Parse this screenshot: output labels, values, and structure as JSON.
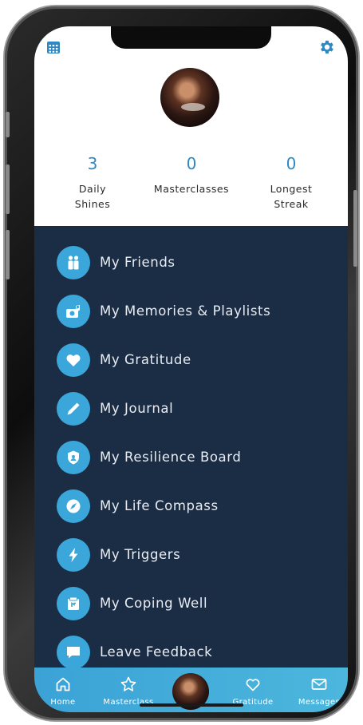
{
  "profile": {
    "stats": [
      {
        "value": "3",
        "label_line1": "Daily",
        "label_line2": "Shines"
      },
      {
        "value": "0",
        "label_line1": "Masterclasses",
        "label_line2": ""
      },
      {
        "value": "0",
        "label_line1": "Longest",
        "label_line2": "Streak"
      }
    ]
  },
  "menu": {
    "items": [
      {
        "label": "My Friends",
        "icon": "friends-icon"
      },
      {
        "label": "My Memories & Playlists",
        "icon": "memories-camera-icon"
      },
      {
        "label": "My Gratitude",
        "icon": "heart-icon"
      },
      {
        "label": "My Journal",
        "icon": "pen-icon"
      },
      {
        "label": "My Resilience Board",
        "icon": "shield-icon"
      },
      {
        "label": "My Life Compass",
        "icon": "compass-icon"
      },
      {
        "label": "My Triggers",
        "icon": "lightning-icon"
      },
      {
        "label": "My Coping Well",
        "icon": "coping-well-icon"
      },
      {
        "label": "Leave Feedback",
        "icon": "chat-bubble-icon"
      }
    ]
  },
  "tabbar": {
    "home": "Home",
    "masterclass": "Masterclass",
    "gratitude": "Gratitude",
    "messages": "Messages"
  },
  "colors": {
    "accent": "#3aa6d9",
    "menu_background": "#1b2c45",
    "stat_number": "#2d88c4"
  }
}
